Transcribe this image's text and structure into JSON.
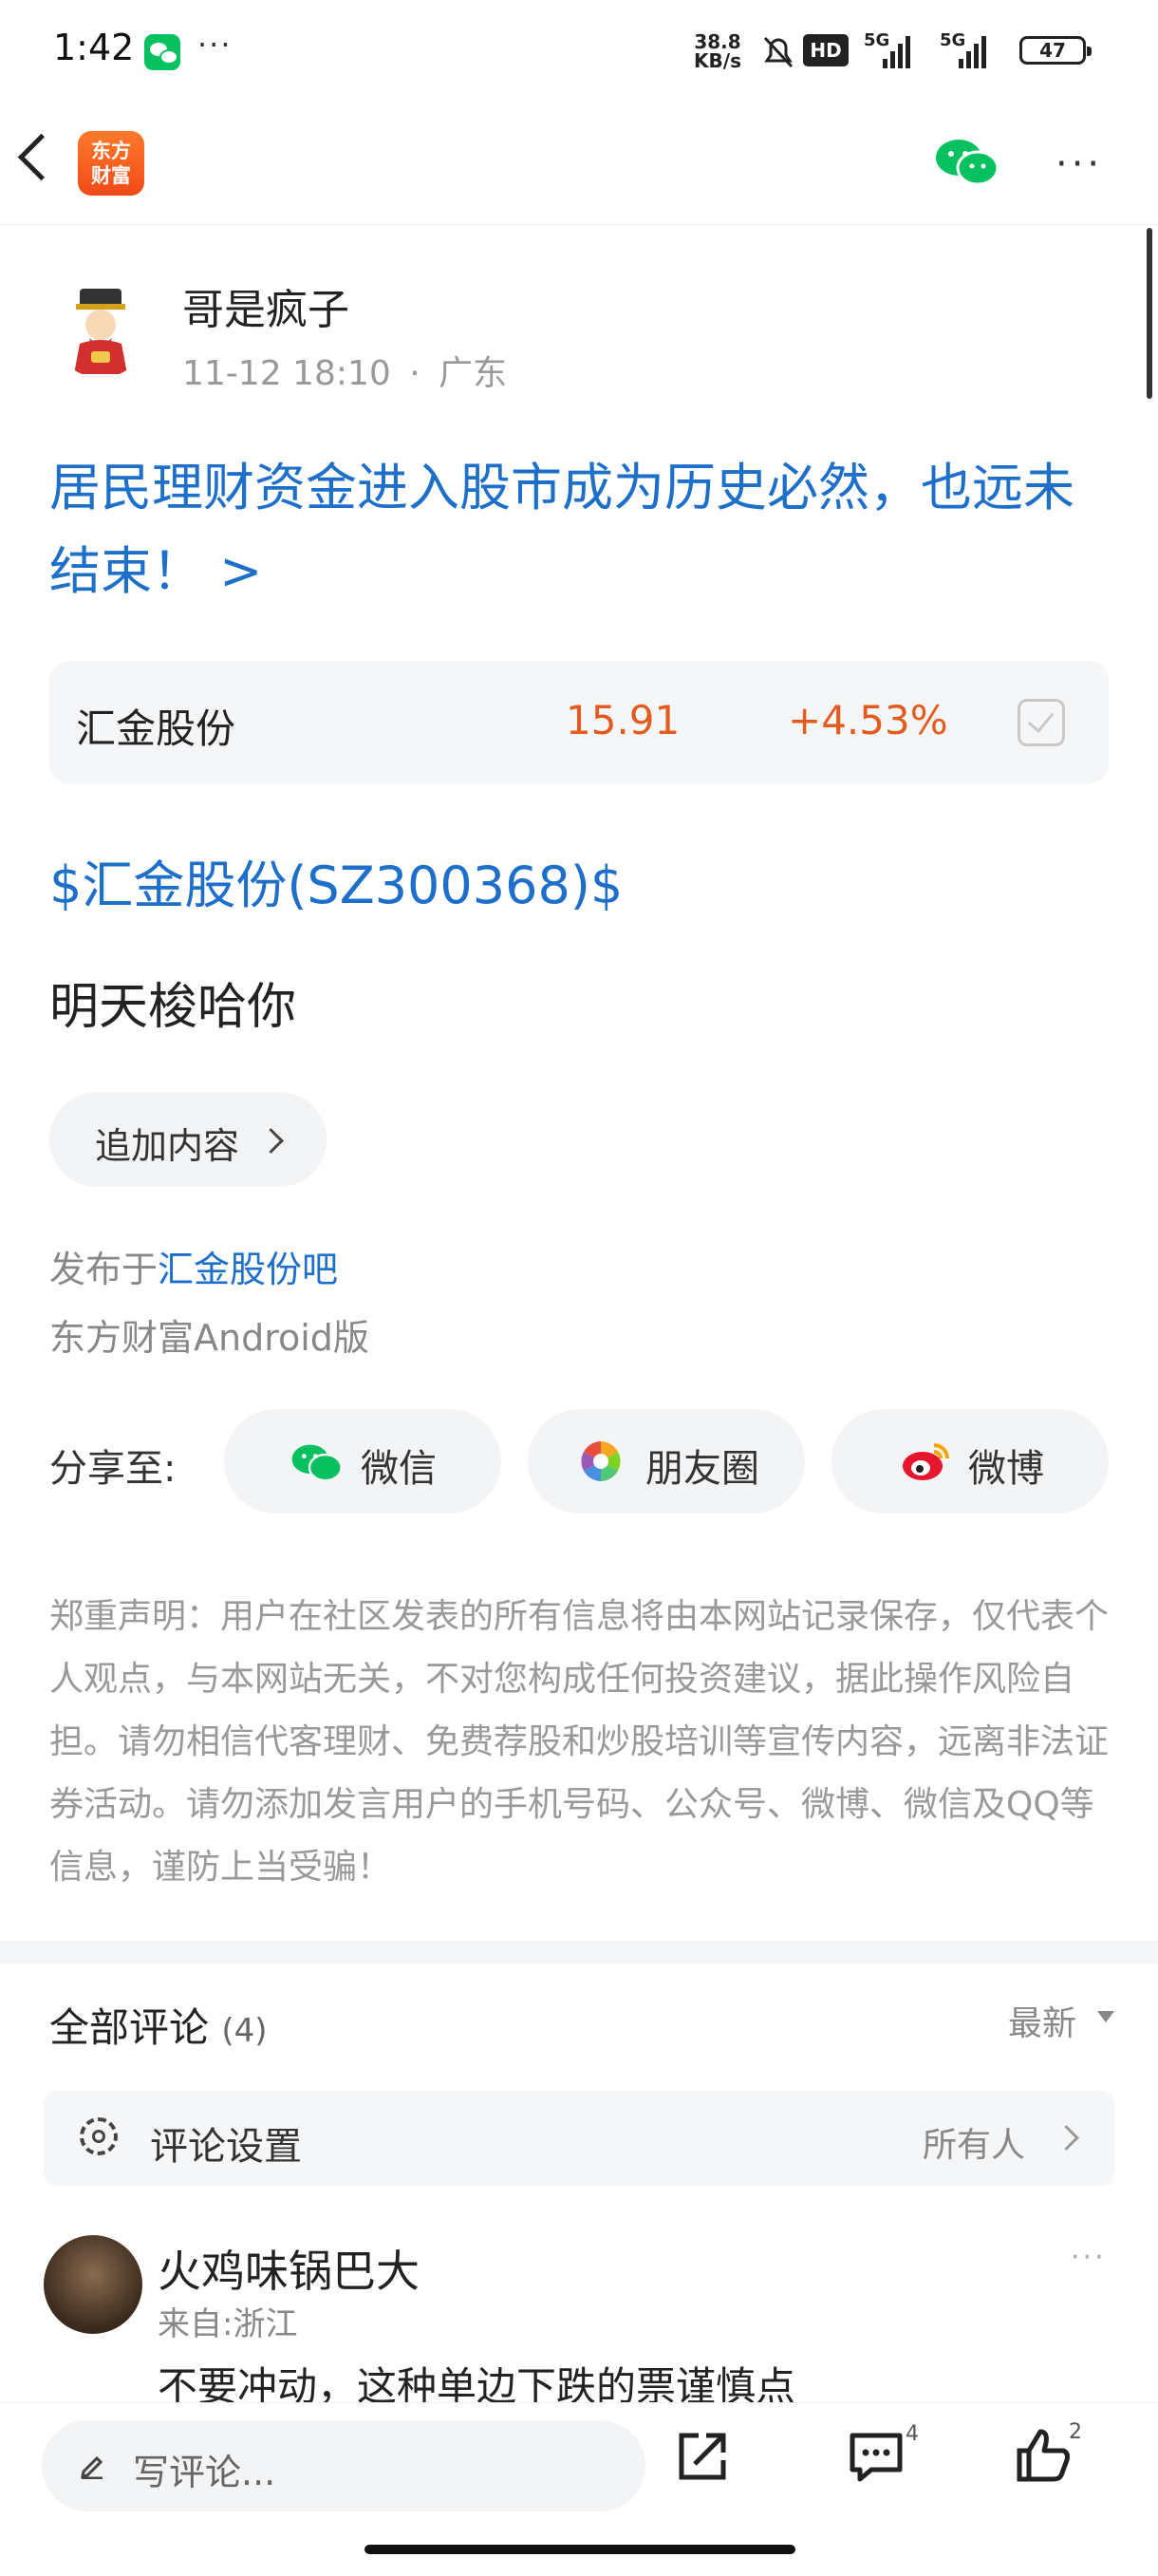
{
  "status_bar": {
    "time": "1:42",
    "more": "···",
    "net_speed_value": "38.8",
    "net_speed_unit": "KB/s",
    "hd_label": "HD",
    "signal1": "5G",
    "signal2": "5G",
    "battery": "47"
  },
  "header": {
    "logo_line1": "东方",
    "logo_line2": "财富",
    "more": "···"
  },
  "post": {
    "author": "哥是疯子",
    "date": "11-12 18:10",
    "separator": "·",
    "location": "广东",
    "title": "居民理财资金进入股市成为历史必然，也远未结束！ >",
    "stock": {
      "name": "汇金股份",
      "price": "15.91",
      "change": "+4.53%"
    },
    "stock_tag": "$汇金股份(SZ300368)$",
    "body": "明天梭哈你",
    "add_content": "追加内容",
    "published_prefix": "发布于",
    "published_forum": "汇金股份吧",
    "client": "东方财富Android版"
  },
  "share": {
    "label": "分享至:",
    "wechat": "微信",
    "moments": "朋友圈",
    "weibo": "微博"
  },
  "disclaimer": "郑重声明：用户在社区发表的所有信息将由本网站记录保存，仅代表个人观点，与本网站无关，不对您构成任何投资建议，据此操作风险自担。请勿相信代客理财、免费荐股和炒股培训等宣传内容，远离非法证券活动。请勿添加发言用户的手机号码、公众号、微博、微信及QQ等信息，谨防上当受骗！",
  "comments": {
    "title": "全部评论",
    "count": "(4)",
    "sort": "最新",
    "settings_label": "评论设置",
    "settings_value": "所有人",
    "items": [
      {
        "name": "火鸡味锅巴大",
        "location": "来自:浙江",
        "text": "不要冲动，这种单边下跌的票谨慎点",
        "more": "···"
      }
    ]
  },
  "bottom_bar": {
    "write_placeholder": "写评论...",
    "comment_count": "4",
    "like_count": "2"
  },
  "colors": {
    "link_blue": "#1e6fc9",
    "stock_red": "#e35b1e",
    "brand_orange": "#f04a17",
    "wechat_green": "#07c160"
  }
}
